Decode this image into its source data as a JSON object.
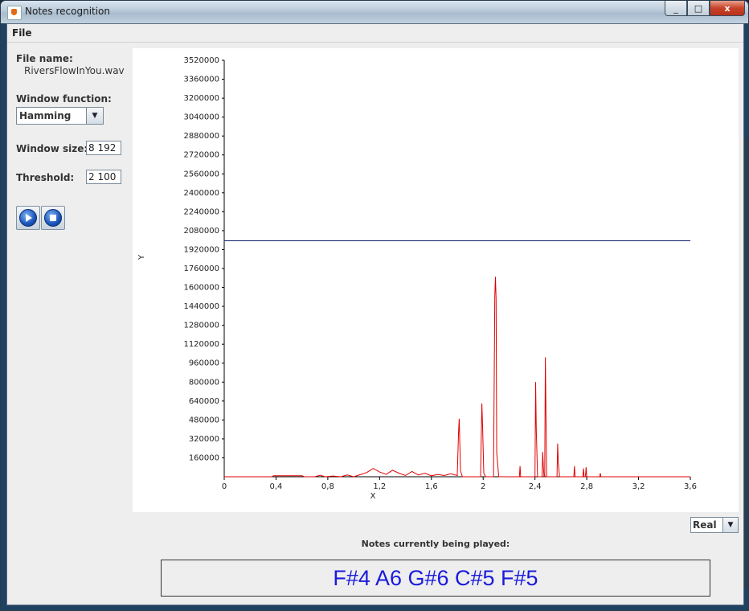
{
  "window": {
    "title": "Notes recognition",
    "controls": {
      "minimize": "_",
      "maximize": "□",
      "close": "x"
    }
  },
  "menu": {
    "file": "File"
  },
  "sidebar": {
    "file_name_label": "File name:",
    "file_name_value": "RiversFlowInYou.wav",
    "window_function_label": "Window function:",
    "window_function_value": "Hamming",
    "window_size_label": "Window size:",
    "window_size_value": "8 192",
    "threshold_label": "Threshold:",
    "threshold_value": "2 100"
  },
  "view_select": {
    "value": "Real"
  },
  "notes": {
    "title": "Notes currently being played:",
    "value": "F#4 A6 G#6 C#5 F#5"
  },
  "chart_data": {
    "type": "line",
    "xlabel": "X",
    "ylabel": "Y",
    "xlim": [
      0,
      3.6
    ],
    "ylim": [
      0,
      3520000
    ],
    "x_ticks": [
      "0",
      "0,4",
      "0,8",
      "1,2",
      "1,6",
      "2",
      "2,4",
      "2,8",
      "3,2",
      "3,6"
    ],
    "y_ticks": [
      "160000",
      "320000",
      "480000",
      "640000",
      "800000",
      "960000",
      "1120000",
      "1280000",
      "1440000",
      "1600000",
      "1760000",
      "1920000",
      "2080000",
      "2240000",
      "2400000",
      "2560000",
      "2720000",
      "2880000",
      "3040000",
      "3200000",
      "3360000",
      "3520000"
    ],
    "threshold": 1995000,
    "series": [
      {
        "color": "#e00000",
        "points": [
          [
            0.0,
            0
          ],
          [
            0.37,
            0
          ],
          [
            0.38,
            8000
          ],
          [
            0.6,
            8000
          ],
          [
            0.62,
            0
          ],
          [
            0.7,
            0
          ],
          [
            0.74,
            12000
          ],
          [
            0.78,
            0
          ],
          [
            0.84,
            6000
          ],
          [
            0.9,
            0
          ],
          [
            0.95,
            15000
          ],
          [
            1.0,
            0
          ],
          [
            1.05,
            18000
          ],
          [
            1.1,
            35000
          ],
          [
            1.15,
            70000
          ],
          [
            1.2,
            40000
          ],
          [
            1.25,
            20000
          ],
          [
            1.3,
            55000
          ],
          [
            1.35,
            30000
          ],
          [
            1.4,
            10000
          ],
          [
            1.45,
            45000
          ],
          [
            1.5,
            15000
          ],
          [
            1.55,
            30000
          ],
          [
            1.6,
            8000
          ],
          [
            1.65,
            20000
          ],
          [
            1.7,
            10000
          ],
          [
            1.75,
            25000
          ],
          [
            1.8,
            10000
          ],
          [
            1.81,
            380000
          ],
          [
            1.815,
            490000
          ],
          [
            1.825,
            50000
          ],
          [
            1.84,
            0
          ],
          [
            1.98,
            0
          ],
          [
            1.99,
            620000
          ],
          [
            1.995,
            450000
          ],
          [
            2.005,
            30000
          ],
          [
            2.02,
            0
          ],
          [
            2.08,
            0
          ],
          [
            2.09,
            1530000
          ],
          [
            2.095,
            1690000
          ],
          [
            2.1,
            1500000
          ],
          [
            2.105,
            200000
          ],
          [
            2.12,
            0
          ],
          [
            2.28,
            0
          ],
          [
            2.285,
            90000
          ],
          [
            2.29,
            0
          ],
          [
            2.4,
            0
          ],
          [
            2.405,
            800000
          ],
          [
            2.41,
            400000
          ],
          [
            2.42,
            0
          ],
          [
            2.455,
            0
          ],
          [
            2.46,
            210000
          ],
          [
            2.465,
            90000
          ],
          [
            2.47,
            0
          ],
          [
            2.475,
            0
          ],
          [
            2.48,
            1010000
          ],
          [
            2.485,
            500000
          ],
          [
            2.49,
            0
          ],
          [
            2.57,
            0
          ],
          [
            2.575,
            280000
          ],
          [
            2.58,
            120000
          ],
          [
            2.59,
            0
          ],
          [
            2.7,
            0
          ],
          [
            2.705,
            90000
          ],
          [
            2.71,
            0
          ],
          [
            2.77,
            0
          ],
          [
            2.775,
            70000
          ],
          [
            2.78,
            0
          ],
          [
            2.79,
            0
          ],
          [
            2.795,
            80000
          ],
          [
            2.8,
            0
          ],
          [
            2.9,
            0
          ],
          [
            2.905,
            30000
          ],
          [
            2.91,
            0
          ],
          [
            3.6,
            0
          ]
        ]
      }
    ]
  }
}
